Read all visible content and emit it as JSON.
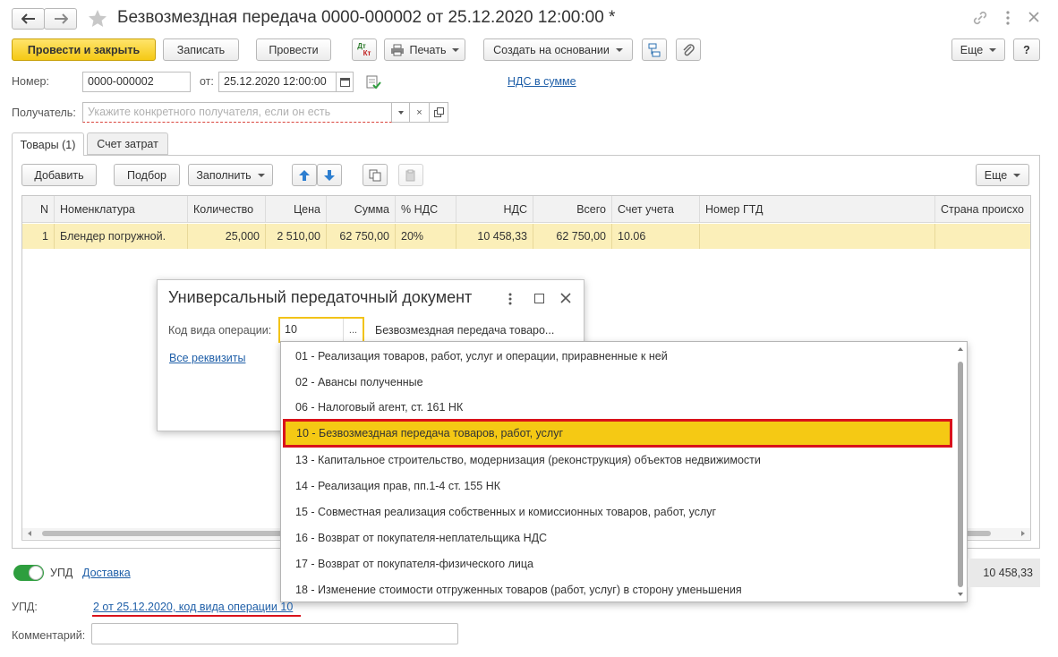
{
  "header": {
    "title": "Безвозмездная передача 0000-000002 от 25.12.2020 12:00:00 *"
  },
  "toolbar": {
    "post_close": "Провести и закрыть",
    "save": "Записать",
    "post": "Провести",
    "dtkt_top": "Дт",
    "dtkt_bottom": "Кт",
    "print": "Печать",
    "create_based": "Создать на основании",
    "more": "Еще",
    "help": "?"
  },
  "form": {
    "number_label": "Номер:",
    "number_value": "0000-000002",
    "date_label": "от:",
    "date_value": "25.12.2020 12:00:00",
    "vat_link": "НДС в сумме",
    "recipient_label": "Получатель:",
    "recipient_placeholder": "Укажите конкретного получателя, если он есть"
  },
  "tabs": [
    {
      "label": "Товары (1)"
    },
    {
      "label": "Счет затрат"
    }
  ],
  "table_toolbar": {
    "add": "Добавить",
    "select": "Подбор",
    "fill": "Заполнить",
    "more": "Еще"
  },
  "table": {
    "columns": [
      "N",
      "Номенклатура",
      "Количество",
      "Цена",
      "Сумма",
      "% НДС",
      "НДС",
      "Всего",
      "Счет учета",
      "Номер ГТД",
      "Страна происхо"
    ],
    "rows": [
      [
        "1",
        "Блендер погружной.",
        "25,000",
        "2 510,00",
        "62 750,00",
        "20%",
        "10 458,33",
        "62 750,00",
        "10.06",
        "",
        ""
      ]
    ]
  },
  "upd_popup": {
    "title": "Универсальный передаточный документ",
    "code_label": "Код вида операции:",
    "code_value": "10",
    "code_description": "Безвозмездная передача товаро...",
    "all_props_link": "Все реквизиты",
    "ellipsis": "..."
  },
  "dropdown": {
    "items": [
      "01 - Реализация товаров, работ, услуг и операции, приравненные к ней",
      "02 - Авансы полученные",
      "06 - Налоговый агент, ст. 161 НК",
      "10 - Безвозмездная передача товаров, работ, услуг",
      "13 - Капитальное строительство, модернизация (реконструкция) объектов недвижимости",
      "14 - Реализация прав, пп.1-4 ст. 155 НК",
      "15 - Совместная реализация собственных и комиссионных товаров, работ, услуг",
      "16 - Возврат от покупателя-неплательщика НДС",
      "17 - Возврат от покупателя-физического лица",
      "18 - Изменение стоимости отгруженных товаров (работ, услуг) в сторону уменьшения"
    ],
    "selected_index": 3
  },
  "footer": {
    "upd_toggle_label": "УПД",
    "delivery_link": "Доставка",
    "total_vat": "10 458,33",
    "upd_label": "УПД:",
    "upd_link": "2 от 25.12.2020, код вида операции 10",
    "comment_label": "Комментарий:"
  },
  "colors": {
    "accent_yellow": "#f5c914",
    "selection_row": "#fbefb9",
    "highlight_red": "#d9121b",
    "link_blue": "#1f5fa8",
    "toggle_green": "#2e9e3e"
  }
}
